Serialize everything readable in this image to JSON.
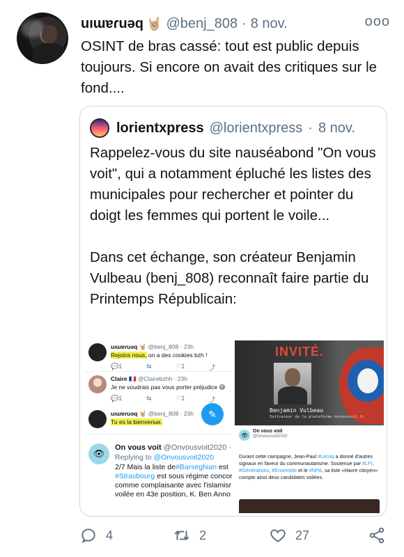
{
  "tweet": {
    "display_name": "uıɯɐɾuǝq",
    "hand_emoji": "🤘🏼",
    "handle": "@benj_808",
    "separator": "·",
    "date": "8 nov.",
    "more_label": "ooo",
    "text": "OSINT de bras cassé: tout est public depuis toujours. Si encore on avait des critiques sur le fond...."
  },
  "quote": {
    "display_name": "lorientxpress",
    "handle": "@lorientxpress",
    "separator": "·",
    "date": "8 nov.",
    "paragraph_1": "Rappelez-vous du site nauséabond \"On vous voit\", qui a notamment épluché les listes des municipales pour rechercher et pointer du doigt les femmes qui portent le voile...",
    "paragraph_2": "Dans cet échange, son créateur Benjamin Vulbeau (benj_808) reconnaît faire partie du Printemps Républicain:"
  },
  "media_left": {
    "reply1": {
      "name": "uıɯɐɾuǝq",
      "hand": "🤘🏼",
      "handle": "@benj_808 · 23h",
      "text": "Rejoins nous,",
      "text_rest": " on a des cookies bzh !",
      "counts": [
        "1",
        "",
        "1",
        ""
      ]
    },
    "reply2": {
      "name": "Claire",
      "flag": "🇫🇷",
      "handle": "@Clairebzhh · 23h",
      "text": "Je ne voudrais pas vous porter préjudice 😅",
      "counts": [
        "1",
        "",
        "1",
        ""
      ]
    },
    "reply3": {
      "name": "uıɯɐɾuǝq",
      "hand": "🤘🏼",
      "handle": "@benj_808 · 23h",
      "text": "Tu es la bienvenue."
    },
    "ov": {
      "name": "On vous voit",
      "handle": "@Onvousvoit2020 · M",
      "replying": "Replying to",
      "replying_to": "@Onvousvoit2020",
      "line1": "2/7 Mais la liste de",
      "line1_tag": "#Barseghian",
      "line1_end": " est",
      "line2_tag": "#Strasbourg",
      "line2": " est sous régime concor",
      "line3": "comme complaisante avec l'islamisr",
      "line4": "voilée en 43e position,  K. Ben Anno"
    }
  },
  "media_right": {
    "invite_title": "INVITÉ.",
    "invite_name": "Benjamin Vulbeau",
    "invite_sub": "Initiateur de la plateforme onvousvoit.fr",
    "ov_name": "On vous voit",
    "ov_handle": "@Onvousvoit2020",
    "text_a": "Durant cette campagne, Jean-Paul ",
    "tag_lecoq": "#Lecoq",
    "text_b": " a donné d'autres signaux en faveur du communautarisme. Soutenue par ",
    "tag_lfi": "#LFI",
    "text_c": ", ",
    "tag_gen": "#Générations",
    "tag_ens": "#Ensemble",
    "text_d": " et le ",
    "tag_npa": "#NPA",
    "text_e": ", sa liste «Havre citoyen» compte ainsi deux candidates voilées."
  },
  "actions": {
    "reply_count": "4",
    "retweet_count": "2",
    "like_count": "27"
  },
  "colors": {
    "link": "#1d9bf0",
    "muted": "#5b7083",
    "highlight": "#f5f04a"
  }
}
